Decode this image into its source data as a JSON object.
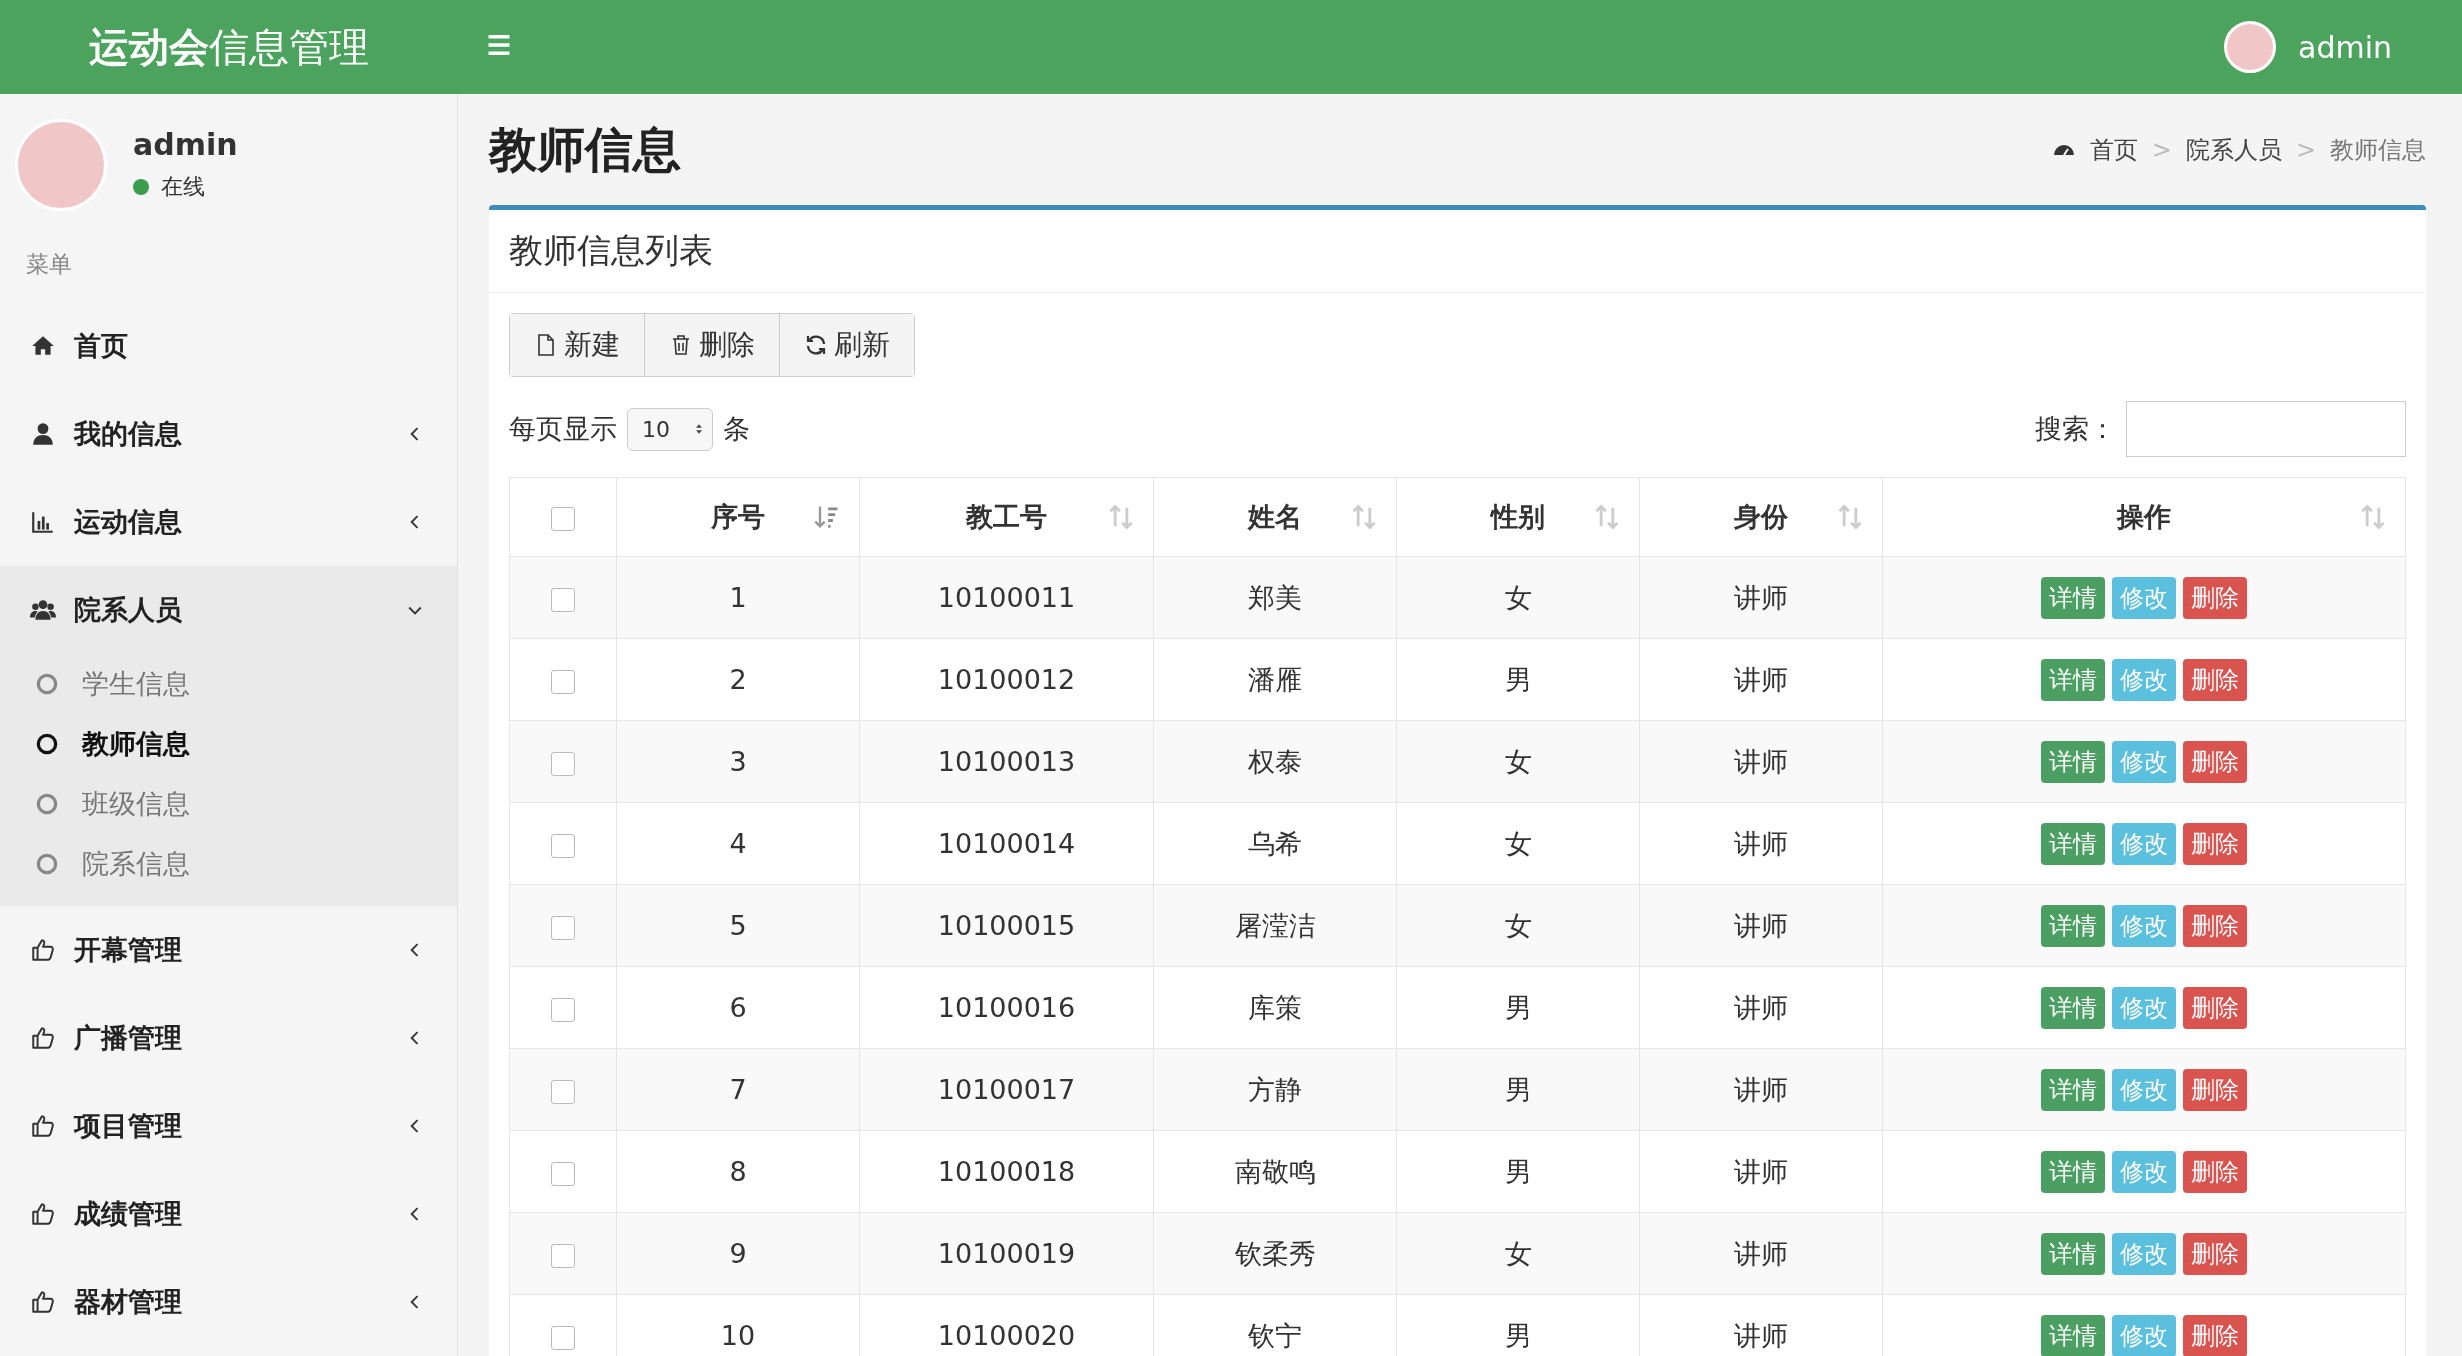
{
  "header": {
    "logo_bold": "运动会",
    "logo_rest": "信息管理",
    "user": "admin"
  },
  "sidebar": {
    "user": {
      "name": "admin",
      "status": "在线",
      "online": true
    },
    "menu_label": "菜单",
    "items": [
      {
        "label": "首页",
        "kind": "link"
      },
      {
        "label": "我的信息",
        "kind": "group",
        "expanded": false
      },
      {
        "label": "运动信息",
        "kind": "group",
        "expanded": false
      },
      {
        "label": "院系人员",
        "kind": "group",
        "expanded": true,
        "children": [
          {
            "label": "学生信息",
            "selected": false
          },
          {
            "label": "教师信息",
            "selected": true
          },
          {
            "label": "班级信息",
            "selected": false
          },
          {
            "label": "院系信息",
            "selected": false
          }
        ]
      },
      {
        "label": "开幕管理",
        "kind": "group",
        "expanded": false
      },
      {
        "label": "广播管理",
        "kind": "group",
        "expanded": false
      },
      {
        "label": "项目管理",
        "kind": "group",
        "expanded": false
      },
      {
        "label": "成绩管理",
        "kind": "group",
        "expanded": false
      },
      {
        "label": "器材管理",
        "kind": "group",
        "expanded": false
      }
    ]
  },
  "content": {
    "title": "教师信息",
    "breadcrumb": [
      {
        "label": "首页"
      },
      {
        "separator": ">",
        "label": "院系人员"
      },
      {
        "separator": ">",
        "label": "教师信息"
      }
    ],
    "box": {
      "title": "教师信息列表",
      "toolbar": [
        {
          "label": "新建"
        },
        {
          "label": "删除"
        },
        {
          "label": "刷新"
        }
      ],
      "page_length": {
        "prefix": "每页显示",
        "value": "10",
        "suffix": "条"
      },
      "search": {
        "label": "搜索："
      },
      "table": {
        "select_all": {
          "checked": false
        },
        "columns": [
          {
            "label": "序号",
            "sorted": true
          },
          {
            "label": "教工号",
            "sorted": false
          },
          {
            "label": "姓名",
            "sorted": false
          },
          {
            "label": "性别",
            "sorted": false
          },
          {
            "label": "身份",
            "sorted": false
          },
          {
            "label": "操作",
            "sorted": false
          }
        ],
        "rows": [
          {
            "checked": false,
            "cells": [
              "1",
              "10100011",
              "郑美",
              "女",
              "讲师"
            ],
            "actions": [
              {
                "label": "详情",
                "kind": "view"
              },
              {
                "label": "修改",
                "kind": "edit"
              },
              {
                "label": "删除",
                "kind": "delete"
              }
            ]
          },
          {
            "checked": false,
            "cells": [
              "2",
              "10100012",
              "潘雁",
              "男",
              "讲师"
            ],
            "actions": [
              {
                "label": "详情",
                "kind": "view"
              },
              {
                "label": "修改",
                "kind": "edit"
              },
              {
                "label": "删除",
                "kind": "delete"
              }
            ]
          },
          {
            "checked": false,
            "cells": [
              "3",
              "10100013",
              "权泰",
              "女",
              "讲师"
            ],
            "actions": [
              {
                "label": "详情",
                "kind": "view"
              },
              {
                "label": "修改",
                "kind": "edit"
              },
              {
                "label": "删除",
                "kind": "delete"
              }
            ]
          },
          {
            "checked": false,
            "cells": [
              "4",
              "10100014",
              "乌希",
              "女",
              "讲师"
            ],
            "actions": [
              {
                "label": "详情",
                "kind": "view"
              },
              {
                "label": "修改",
                "kind": "edit"
              },
              {
                "label": "删除",
                "kind": "delete"
              }
            ]
          },
          {
            "checked": false,
            "cells": [
              "5",
              "10100015",
              "屠滢洁",
              "女",
              "讲师"
            ],
            "actions": [
              {
                "label": "详情",
                "kind": "view"
              },
              {
                "label": "修改",
                "kind": "edit"
              },
              {
                "label": "删除",
                "kind": "delete"
              }
            ]
          },
          {
            "checked": false,
            "cells": [
              "6",
              "10100016",
              "库策",
              "男",
              "讲师"
            ],
            "actions": [
              {
                "label": "详情",
                "kind": "view"
              },
              {
                "label": "修改",
                "kind": "edit"
              },
              {
                "label": "删除",
                "kind": "delete"
              }
            ]
          },
          {
            "checked": false,
            "cells": [
              "7",
              "10100017",
              "方静",
              "男",
              "讲师"
            ],
            "actions": [
              {
                "label": "详情",
                "kind": "view"
              },
              {
                "label": "修改",
                "kind": "edit"
              },
              {
                "label": "删除",
                "kind": "delete"
              }
            ]
          },
          {
            "checked": false,
            "cells": [
              "8",
              "10100018",
              "南敬鸣",
              "男",
              "讲师"
            ],
            "actions": [
              {
                "label": "详情",
                "kind": "view"
              },
              {
                "label": "修改",
                "kind": "edit"
              },
              {
                "label": "删除",
                "kind": "delete"
              }
            ]
          },
          {
            "checked": false,
            "cells": [
              "9",
              "10100019",
              "钦柔秀",
              "女",
              "讲师"
            ],
            "actions": [
              {
                "label": "详情",
                "kind": "view"
              },
              {
                "label": "修改",
                "kind": "edit"
              },
              {
                "label": "删除",
                "kind": "delete"
              }
            ]
          },
          {
            "checked": false,
            "cells": [
              "10",
              "10100020",
              "钦宁",
              "男",
              "讲师"
            ],
            "actions": [
              {
                "label": "详情",
                "kind": "view"
              },
              {
                "label": "修改",
                "kind": "edit"
              },
              {
                "label": "删除",
                "kind": "delete"
              }
            ]
          }
        ]
      }
    }
  }
}
